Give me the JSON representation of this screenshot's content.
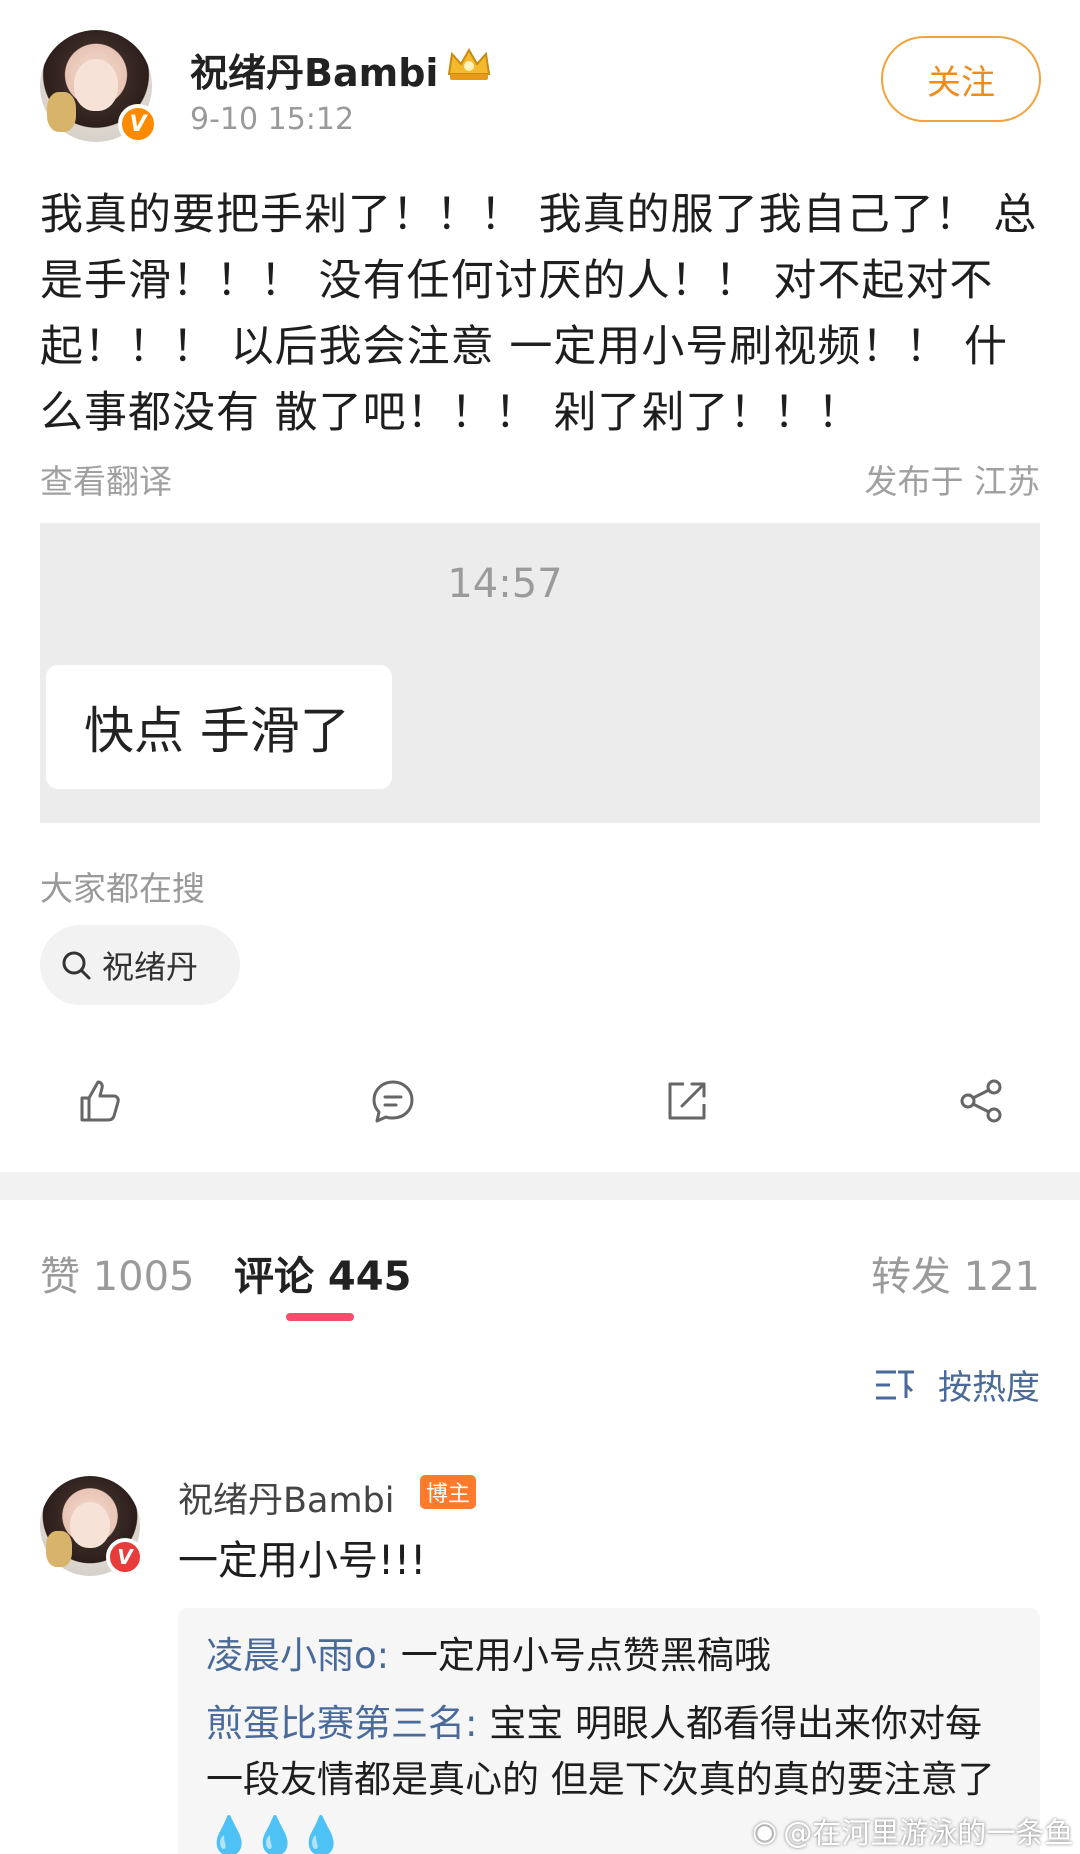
{
  "post": {
    "author": "祝绪丹Bambi",
    "time": "9-10 15:12",
    "follow_label": "关注",
    "text": "我真的要把手剁了！！！ 我真的服了我自己了！ 总是手滑！！！ 没有任何讨厌的人！！ 对不起对不起！！！ 以后我会注意 一定用小号刷视频！！ 什么事都没有 散了吧！！！ 剁了剁了！！！",
    "translate_label": "查看翻译",
    "location": "发布于 江苏",
    "screenshot": {
      "time": "14:57",
      "bubble_text": "快点 手滑了"
    }
  },
  "search": {
    "title": "大家都在搜",
    "chip": "祝绪丹"
  },
  "actions": [
    "like-icon",
    "comment-icon",
    "repost-icon",
    "share-icon"
  ],
  "tabs": {
    "likes": "赞 1005",
    "comments": "评论 445",
    "reposts": "转发 121"
  },
  "sort_label": "按热度",
  "comment": {
    "name": "祝绪丹Bambi",
    "tag": "博主",
    "text": "一定用小号!!!",
    "replies": [
      {
        "user": "凌晨小雨o",
        "text": "一定用小号点赞黑稿哦"
      },
      {
        "user": "煎蛋比赛第三名",
        "text": "宝宝 明眼人都看得出来你对每一段友情都是真心的 但是下次真的真的要注意了💧💧💧"
      }
    ]
  },
  "watermark": "@在河里游泳的一条鱼",
  "colors": {
    "accent_orange": "#f08c1c",
    "tab_underline": "#f24d6b",
    "link_blue": "#4a6a9a"
  }
}
